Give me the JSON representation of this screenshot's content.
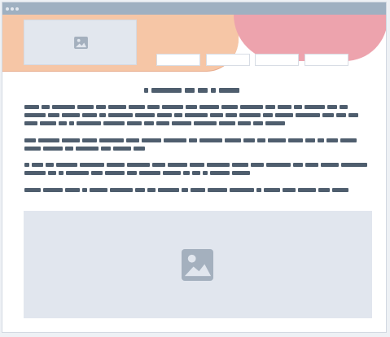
{
  "window": {
    "titlebar_dots": 3
  },
  "header": {
    "logo_icon": "image-placeholder-icon",
    "nav_items": [
      "",
      "",
      "",
      ""
    ]
  },
  "article": {
    "headline_text": "",
    "paragraphs": [
      {
        "line_count": 3
      },
      {
        "line_count": 2
      },
      {
        "line_count": 2
      },
      {
        "line_count": 1
      }
    ]
  },
  "media": {
    "icon": "image-placeholder-icon"
  },
  "colors": {
    "titlebar": "#9fb0c1",
    "hero_peach": "#f6c6a6",
    "hero_pink": "#eda3ad",
    "text_placeholder": "#4f5e6e",
    "image_placeholder": "#e1e6ee"
  }
}
